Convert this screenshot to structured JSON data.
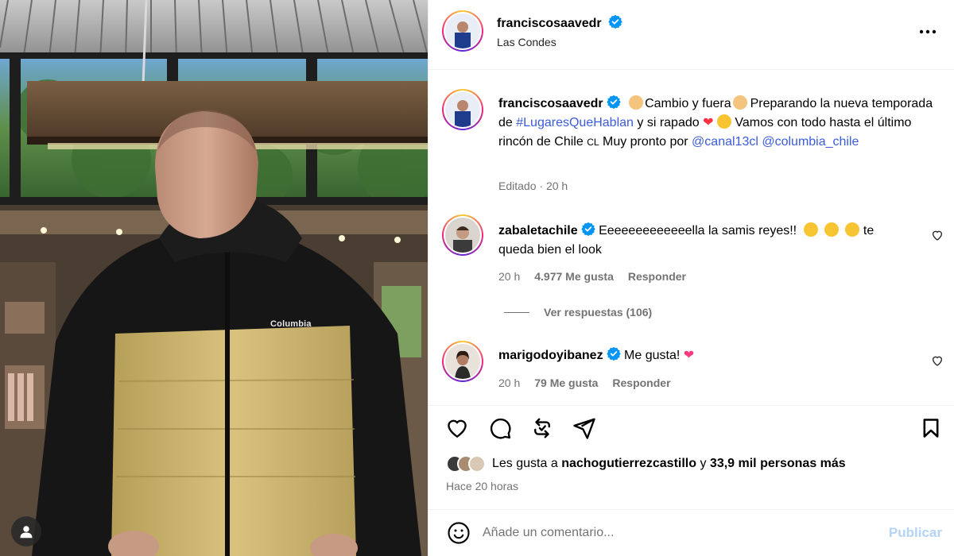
{
  "post": {
    "author": "franciscosaavedr",
    "location": "Las Condes"
  },
  "photo": {
    "brand_on_jacket": "Columbia",
    "tag_icon": "user-tag-icon"
  },
  "caption": {
    "author": "franciscosaavedr",
    "part1": "Cambio y fuera",
    "part2": "Preparando la nueva temporada de",
    "hashtag": "#LugaresQueHablan",
    "part3": "y si rapado",
    "part4": "Vamos con todo hasta el último rincón de Chile",
    "flag_text": "CL",
    "part5": "Muy pronto por",
    "mention1": "@canal13cl",
    "mention2": "@columbia_chile",
    "meta_edited": "Editado",
    "meta_sep": "·",
    "meta_time": "20 h"
  },
  "comments": [
    {
      "author": "zabaletachile",
      "text1": "Eeeeeeeeeeeeella la samis reyes!!",
      "text2": "te queda bien el look",
      "time": "20 h",
      "likes": "4.977 Me gusta",
      "reply": "Responder",
      "view_replies": "Ver respuestas (106)"
    },
    {
      "author": "marigodoyibanez",
      "text": "Me gusta!",
      "time": "20 h",
      "likes": "79 Me gusta",
      "reply": "Responder"
    }
  ],
  "likes": {
    "prefix": "Les gusta a",
    "user": "nachogutierrezcastillo",
    "connector": "y",
    "others": "33,9 mil personas más"
  },
  "posted_ago": "Hace 20 horas",
  "composer": {
    "placeholder": "Añade un comentario...",
    "publish": "Publicar"
  },
  "colors": {
    "verified": "#0095f6",
    "heart": "#ff3040",
    "publish_disabled": "#b3d4f7"
  }
}
